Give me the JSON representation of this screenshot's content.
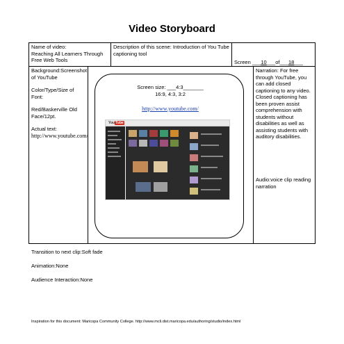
{
  "title": "Video Storyboard",
  "header": {
    "name_label": "Name of video:",
    "name_value": "Reaching All Learners Through Free Web Tools",
    "desc_label": "Description of this scene:",
    "desc_value": "Introduction of  You Tube captioning tool",
    "screen_prefix": "Screen",
    "screen_blank1": "___",
    "screen_num": "10",
    "screen_of": "___of",
    "screen_blank2": "___",
    "screen_total": "18",
    "screen_blank3": "___"
  },
  "left": {
    "background": "Background:Screenshot of YouTube",
    "font_label": "Color/Type/Size of Font:",
    "font_value": "Red/Baskerville Old Face/12pt.",
    "actual_label": "Actual text:",
    "actual_value": "http://www.youtube.com/"
  },
  "frame": {
    "screen_size_line1": "Screen size: ___4:3_______",
    "screen_size_line2": "16:9, 4:3, 3:2",
    "url": "http://www.youtube.com/"
  },
  "right": {
    "narration": "Narration: For free through YouTube, you can add closed captioning to any video. Closed captioning has been proven assist comprehension with students without disabilities as well as assisting students with auditory disabilities.",
    "audio": "Audio:voice clip reading narration"
  },
  "below": {
    "transition": "Transition to next clip:Soft fade",
    "animation": "Animation:None",
    "interaction": "Audience Interaction:None"
  },
  "footer": "Inspiration for this document: Maricopa Community College. http://www.mcli.dist.maricopa.edu/authoring/studio/index.html",
  "screenshot": {
    "logo_text": "You",
    "logo_badge": "Tube"
  }
}
